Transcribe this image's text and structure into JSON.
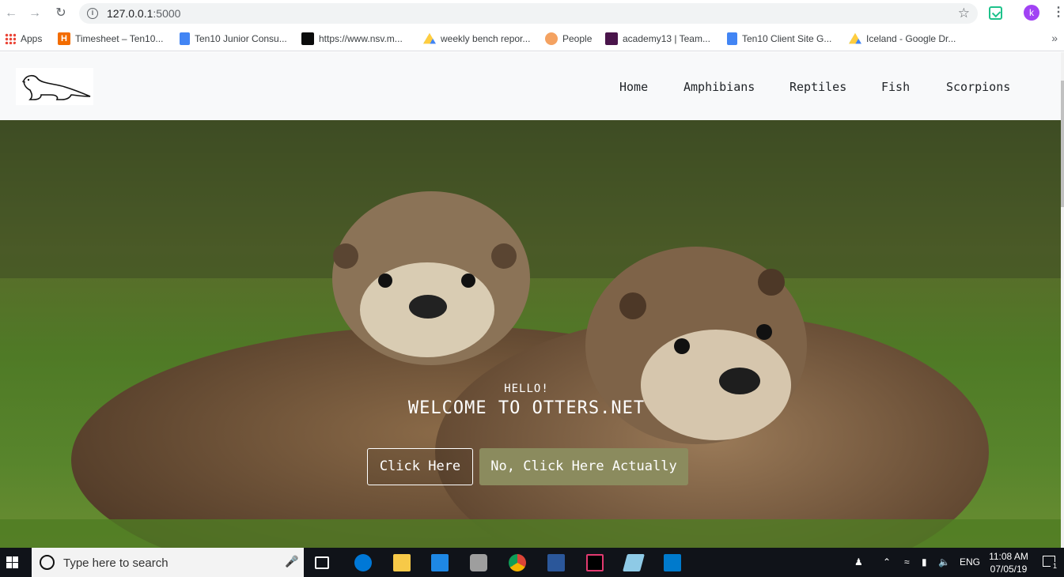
{
  "browser": {
    "url_host": "127.0.0.1",
    "url_port": ":5000",
    "profile_initial": "k",
    "bookmarks": [
      {
        "label": "Apps",
        "icon": "apps-grid-icon"
      },
      {
        "label": "Timesheet – Ten10...",
        "icon": "harvest-icon"
      },
      {
        "label": "Ten10 Junior Consu...",
        "icon": "google-docs-icon"
      },
      {
        "label": "https://www.nsv.m...",
        "icon": "crown-icon"
      },
      {
        "label": "weekly bench repor...",
        "icon": "google-drive-icon"
      },
      {
        "label": "People",
        "icon": "people-icon"
      },
      {
        "label": "academy13 | Team...",
        "icon": "slack-icon"
      },
      {
        "label": "Ten10 Client Site G...",
        "icon": "google-docs-icon"
      },
      {
        "label": "Iceland - Google Dr...",
        "icon": "google-drive-icon"
      }
    ],
    "more_label": "»"
  },
  "site": {
    "nav": [
      "Home",
      "Amphibians",
      "Reptiles",
      "Fish",
      "Scorpions"
    ],
    "hero": {
      "hello": "HELLO!",
      "title": "WELCOME TO OTTERS.NET",
      "primary_button": "Click Here",
      "secondary_button": "No, Click Here Actually"
    },
    "colors": {
      "header_bg": "#f8f9fa",
      "secondary_button_bg": "#8b8b5e"
    }
  },
  "taskbar": {
    "search_placeholder": "Type here to search",
    "language": "ENG",
    "time": "11:08 AM",
    "date": "07/05/19",
    "notification_count": "1"
  }
}
